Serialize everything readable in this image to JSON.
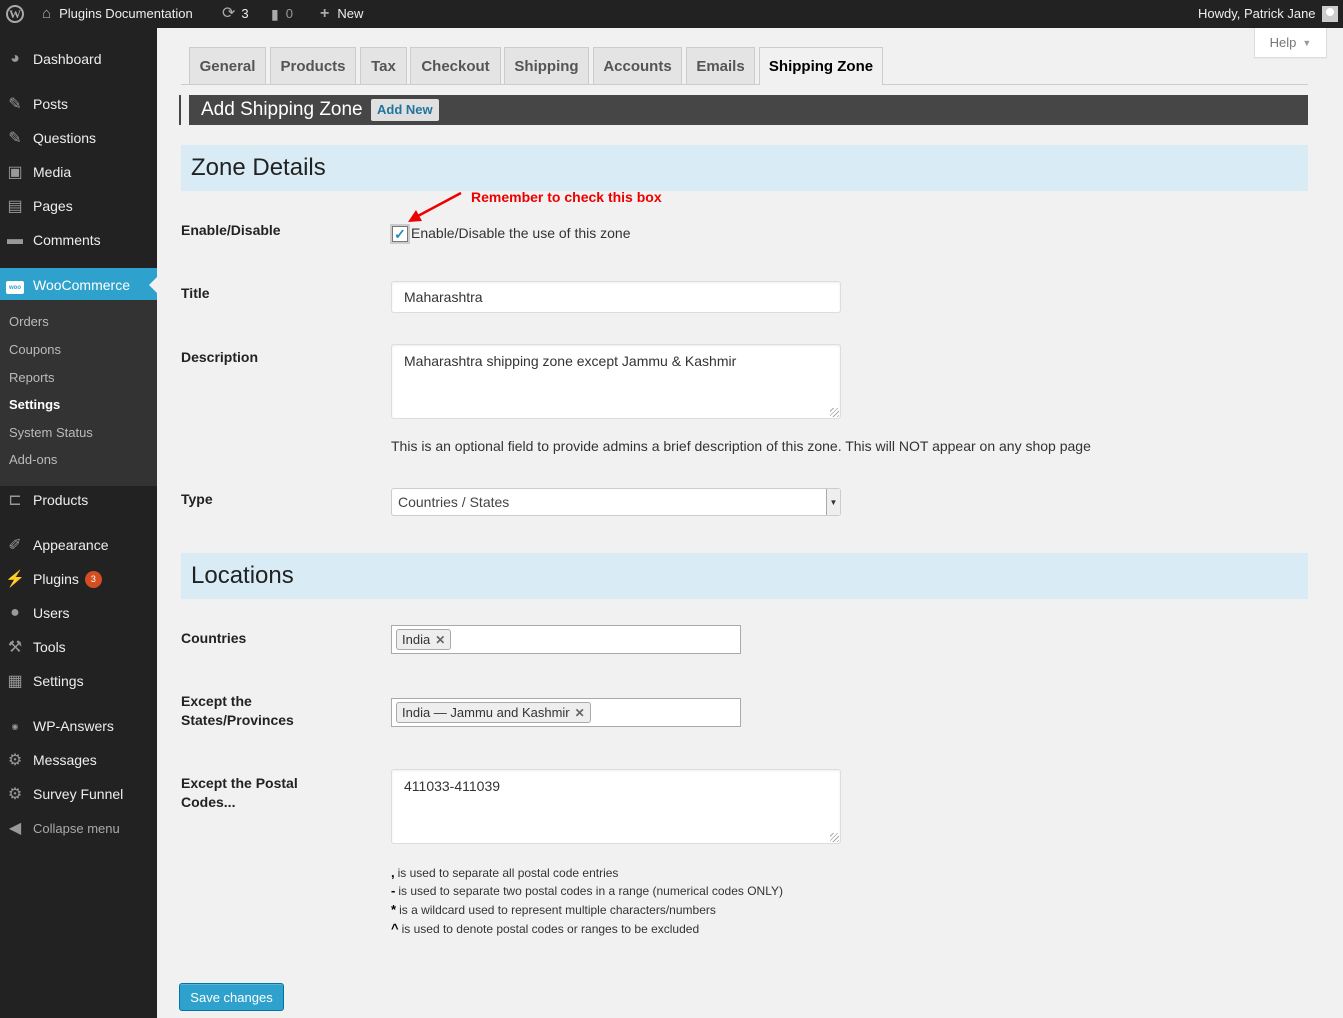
{
  "adminbar": {
    "site_name": "Plugins Documentation",
    "updates_count": "3",
    "comments_count": "0",
    "new_label": "New",
    "greeting": "Howdy, Patrick Jane"
  },
  "sidebar": {
    "items": [
      {
        "label": "Dashboard",
        "icon": "dashboard-icon"
      },
      {
        "label": "Posts",
        "icon": "pin-icon"
      },
      {
        "label": "Questions",
        "icon": "pin-icon"
      },
      {
        "label": "Media",
        "icon": "media-icon"
      },
      {
        "label": "Pages",
        "icon": "pages-icon"
      },
      {
        "label": "Comments",
        "icon": "comment-icon"
      },
      {
        "label": "WooCommerce",
        "icon": "woo-icon"
      },
      {
        "label": "Products",
        "icon": "cart-icon"
      },
      {
        "label": "Appearance",
        "icon": "brush-icon"
      },
      {
        "label": "Plugins",
        "icon": "plug-icon",
        "badge": "3"
      },
      {
        "label": "Users",
        "icon": "user-icon"
      },
      {
        "label": "Tools",
        "icon": "wrench-icon"
      },
      {
        "label": "Settings",
        "icon": "settings-icon"
      },
      {
        "label": "WP-Answers",
        "icon": "woo-icon"
      },
      {
        "label": "Messages",
        "icon": "gear-icon"
      },
      {
        "label": "Survey Funnel",
        "icon": "gear-icon"
      },
      {
        "label": "Collapse menu",
        "icon": "collapse-icon"
      }
    ],
    "woocommerce_sub": [
      "Orders",
      "Coupons",
      "Reports",
      "Settings",
      "System Status",
      "Add-ons"
    ],
    "active_sub": "Settings"
  },
  "help_label": "Help",
  "tabs": [
    "General",
    "Products",
    "Tax",
    "Checkout",
    "Shipping",
    "Accounts",
    "Emails",
    "Shipping Zone"
  ],
  "active_tab": "Shipping Zone",
  "page_header": {
    "title": "Add Shipping Zone",
    "add_new": "Add New"
  },
  "zone_details": {
    "heading": "Zone Details",
    "annotation": "Remember to check this box",
    "enable_label": "Enable/Disable",
    "enable_text": "Enable/Disable the use of this zone",
    "enable_checked": true,
    "title_label": "Title",
    "title_value": "Maharashtra",
    "description_label": "Description",
    "description_value": "Maharashtra shipping zone except Jammu & Kashmir",
    "description_hint": "This is an optional field to provide admins a brief description of this zone. This will NOT appear on any shop page",
    "type_label": "Type",
    "type_value": "Countries / States"
  },
  "locations": {
    "heading": "Locations",
    "countries_label": "Countries",
    "countries_chips": [
      "India"
    ],
    "except_states_label": "Except the States/Provinces",
    "except_states_chips": [
      "India — Jammu and Kashmir"
    ],
    "except_postal_label": "Except the Postal Codes...",
    "except_postal_value": "411033-411039",
    "hints": [
      {
        "symbol": ",",
        "text": "is used to separate all postal code entries"
      },
      {
        "symbol": "-",
        "text": "is used to separate two postal codes in a range (numerical codes ONLY)"
      },
      {
        "symbol": "*",
        "text": "is a wildcard used to represent multiple characters/numbers"
      },
      {
        "symbol": "^",
        "text": "is used to denote postal codes or ranges to be excluded"
      }
    ]
  },
  "save_label": "Save changes",
  "colors": {
    "accent": "#2ea2cc",
    "adminbar": "#222222",
    "section_bg": "#d9ecf5",
    "annotation": "#ee0000"
  }
}
